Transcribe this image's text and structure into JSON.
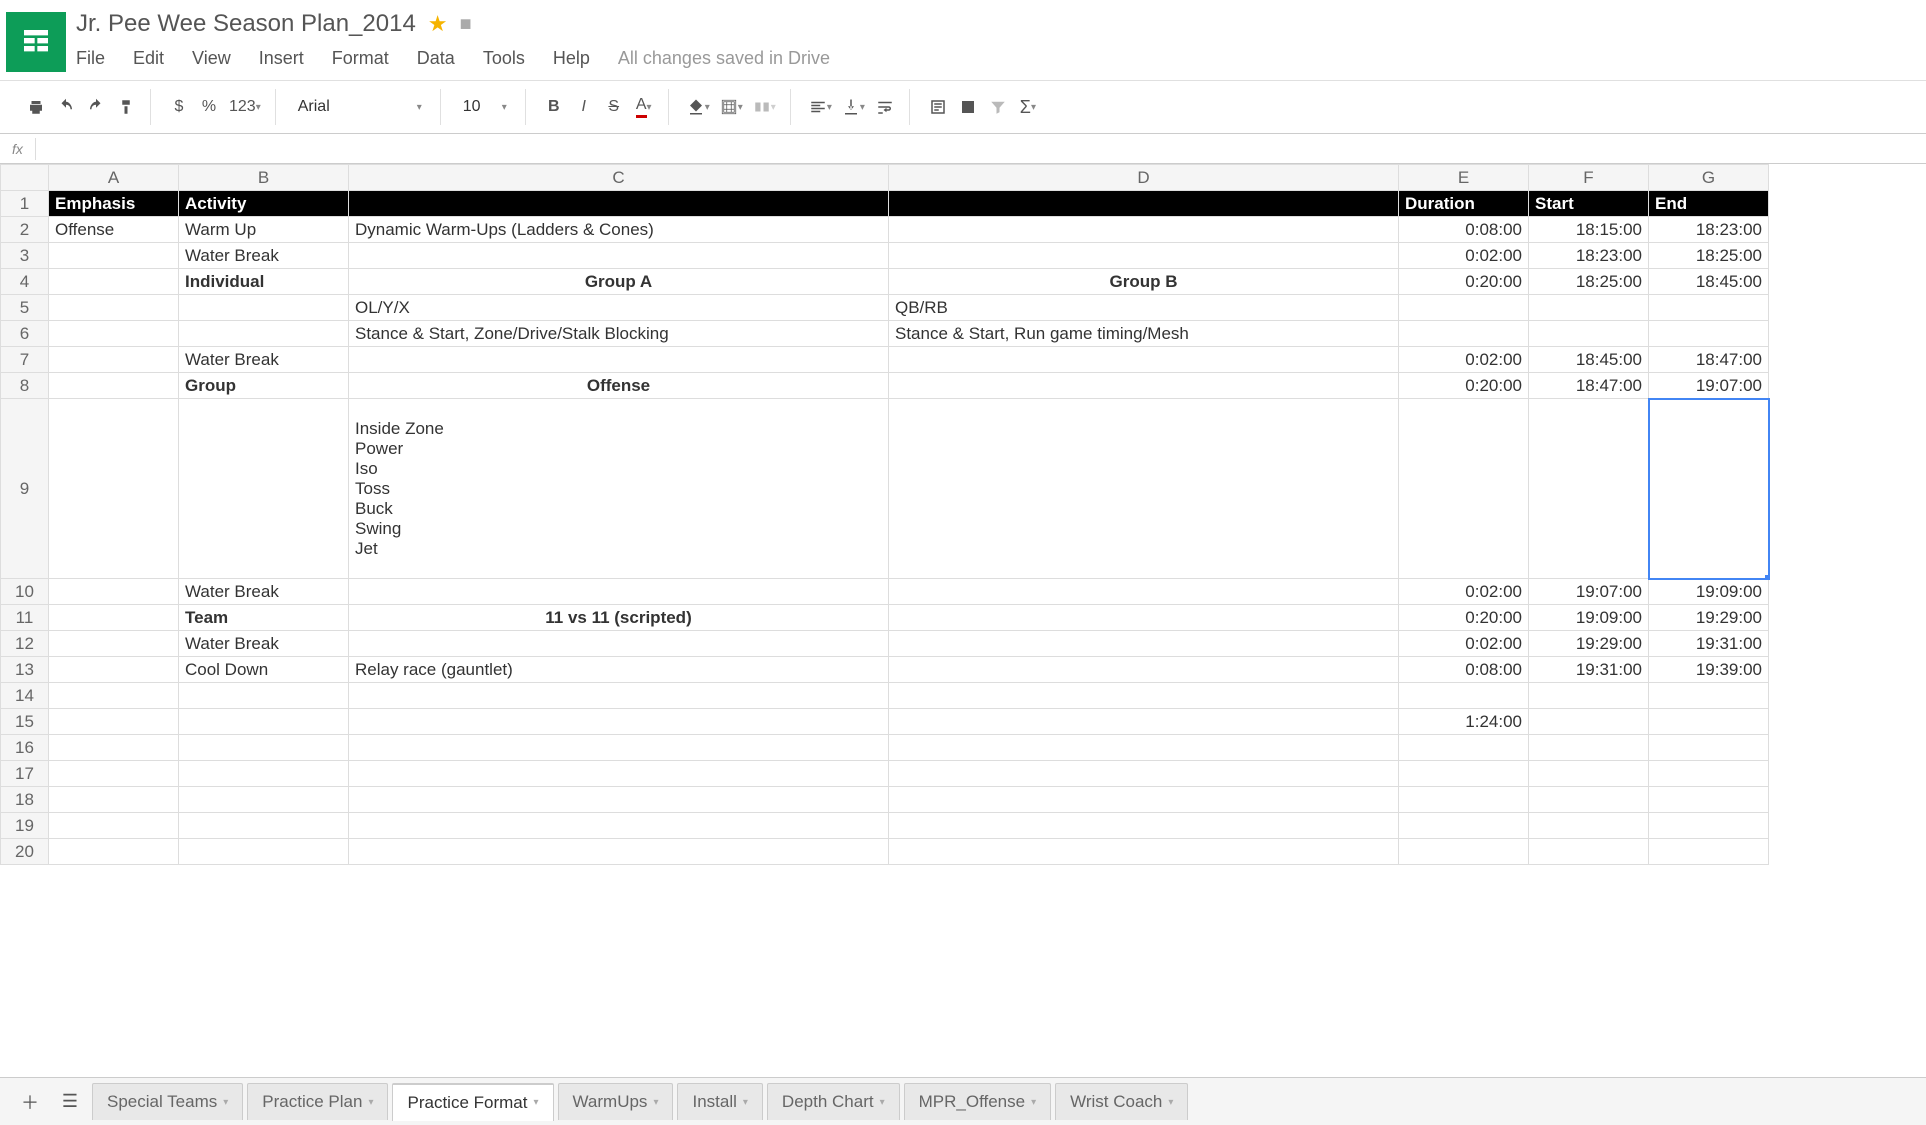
{
  "doc": {
    "title": "Jr. Pee Wee Season Plan_2014",
    "save_status": "All changes saved in Drive"
  },
  "menu": {
    "file": "File",
    "edit": "Edit",
    "view": "View",
    "insert": "Insert",
    "format": "Format",
    "data": "Data",
    "tools": "Tools",
    "help": "Help"
  },
  "toolbar": {
    "currency": "$",
    "percent": "%",
    "numfmt": "123",
    "font": "Arial",
    "size": "10",
    "bold": "B",
    "italic": "I",
    "strike": "S",
    "textcolor": "A",
    "sigma": "Σ"
  },
  "formula": {
    "fx": "fx",
    "value": ""
  },
  "columns": [
    "A",
    "B",
    "C",
    "D",
    "E",
    "F",
    "G"
  ],
  "col_widths": [
    "col-A",
    "col-B",
    "col-C",
    "col-D",
    "col-E",
    "col-F",
    "col-G"
  ],
  "headers": {
    "A": "Emphasis",
    "B": "Activity",
    "C": "",
    "D": "",
    "E": "Duration",
    "F": "Start",
    "G": "End"
  },
  "rows": [
    {
      "n": 2,
      "A": "Offense",
      "B": "Warm Up",
      "C": "Dynamic Warm-Ups (Ladders & Cones)",
      "D": "",
      "E": "0:08:00",
      "F": "18:15:00",
      "G": "18:23:00"
    },
    {
      "n": 3,
      "A": "",
      "B": "Water Break",
      "C": "",
      "D": "",
      "E": "0:02:00",
      "F": "18:23:00",
      "G": "18:25:00"
    },
    {
      "n": 4,
      "A": "",
      "B": "Individual",
      "B_bold": true,
      "C": "Group A",
      "C_bold_center": true,
      "D": "Group B",
      "D_bold_center": true,
      "E": "0:20:00",
      "F": "18:25:00",
      "G": "18:45:00"
    },
    {
      "n": 5,
      "A": "",
      "B": "",
      "C": "OL/Y/X",
      "D": "QB/RB",
      "E": "",
      "F": "",
      "G": ""
    },
    {
      "n": 6,
      "A": "",
      "B": "",
      "C": "Stance & Start, Zone/Drive/Stalk Blocking",
      "D": "Stance & Start, Run game timing/Mesh",
      "E": "",
      "F": "",
      "G": ""
    },
    {
      "n": 7,
      "A": "",
      "B": "Water Break",
      "C": "",
      "D": "",
      "E": "0:02:00",
      "F": "18:45:00",
      "G": "18:47:00"
    },
    {
      "n": 8,
      "A": "",
      "B": "Group",
      "B_bold": true,
      "C": "Offense",
      "C_bold_center": true,
      "D": "",
      "E": "0:20:00",
      "F": "18:47:00",
      "G": "19:07:00"
    },
    {
      "n": 9,
      "tall": true,
      "A": "",
      "B": "",
      "C": "Inside Zone\nPower\nIso\nToss\nBuck\nSwing\nJet",
      "D": "",
      "E": "",
      "F": "",
      "G": "",
      "G_selected": true
    },
    {
      "n": 10,
      "A": "",
      "B": "Water Break",
      "C": "",
      "D": "",
      "E": "0:02:00",
      "F": "19:07:00",
      "G": "19:09:00"
    },
    {
      "n": 11,
      "A": "",
      "B": "Team",
      "B_bold": true,
      "C": "11 vs 11 (scripted)",
      "C_bold_center": true,
      "D": "",
      "E": "0:20:00",
      "F": "19:09:00",
      "G": "19:29:00"
    },
    {
      "n": 12,
      "A": "",
      "B": "Water Break",
      "C": "",
      "D": "",
      "E": "0:02:00",
      "F": "19:29:00",
      "G": "19:31:00"
    },
    {
      "n": 13,
      "A": "",
      "B": "Cool Down",
      "C": "Relay race (gauntlet)",
      "D": "",
      "E": "0:08:00",
      "F": "19:31:00",
      "G": "19:39:00"
    },
    {
      "n": 14,
      "A": "",
      "B": "",
      "C": "",
      "D": "",
      "E": "",
      "F": "",
      "G": ""
    },
    {
      "n": 15,
      "A": "",
      "B": "",
      "C": "",
      "D": "",
      "E": "1:24:00",
      "F": "",
      "G": ""
    },
    {
      "n": 16,
      "A": "",
      "B": "",
      "C": "",
      "D": "",
      "E": "",
      "F": "",
      "G": ""
    },
    {
      "n": 17,
      "A": "",
      "B": "",
      "C": "",
      "D": "",
      "E": "",
      "F": "",
      "G": ""
    },
    {
      "n": 18,
      "A": "",
      "B": "",
      "C": "",
      "D": "",
      "E": "",
      "F": "",
      "G": ""
    },
    {
      "n": 19,
      "A": "",
      "B": "",
      "C": "",
      "D": "",
      "E": "",
      "F": "",
      "G": ""
    },
    {
      "n": 20,
      "A": "",
      "B": "",
      "C": "",
      "D": "",
      "E": "",
      "F": "",
      "G": ""
    }
  ],
  "sheets": {
    "t1": "Special Teams",
    "t2": "Practice Plan",
    "t3": "Practice Format",
    "t4": "WarmUps",
    "t5": "Install",
    "t6": "Depth Chart",
    "t7": "MPR_Offense",
    "t8": "Wrist Coach"
  }
}
